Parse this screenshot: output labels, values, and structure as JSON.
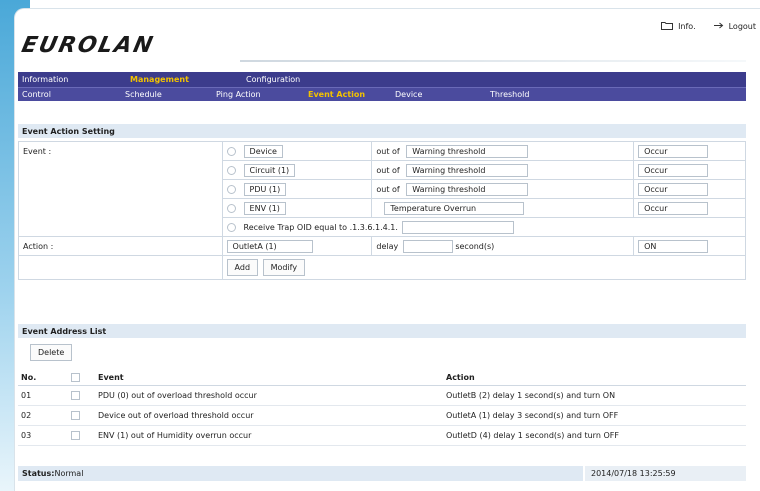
{
  "header": {
    "info_label": "Info.",
    "logout_label": "Logout",
    "logo_text": "EUROLAN"
  },
  "menu": {
    "primary": [
      "Information",
      "Management",
      "Configuration"
    ],
    "primary_active": "Management",
    "secondary": [
      "Control",
      "Schedule",
      "Ping Action",
      "Event Action",
      "Device",
      "Threshold"
    ],
    "secondary_active": "Event Action"
  },
  "event_action_setting": {
    "title": "Event Action Setting",
    "event_label": "Event :",
    "rows": [
      {
        "source": "Device",
        "out_of": "out of",
        "condition": "Warning threshold",
        "state": "Occur"
      },
      {
        "source": "Circuit (1)",
        "out_of": "out of",
        "condition": "Warning threshold",
        "state": "Occur"
      },
      {
        "source": "PDU (1)",
        "out_of": "out of",
        "condition": "Warning threshold",
        "state": "Occur"
      },
      {
        "source": "ENV (1)",
        "out_of": "",
        "condition": "Temperature Overrun",
        "state": "Occur"
      }
    ],
    "trap_label": "Receive Trap OID equal to",
    "trap_prefix": ".1.3.6.1.4.1.",
    "trap_value": "",
    "action_label": "Action :",
    "action_outlet": "OutletA (1)",
    "delay_label": "delay",
    "delay_value": "",
    "seconds_label": "second(s)",
    "action_state": "ON",
    "add_label": "Add",
    "modify_label": "Modify"
  },
  "event_address_list": {
    "title": "Event Address List",
    "delete_label": "Delete",
    "columns": {
      "no": "No.",
      "event": "Event",
      "action": "Action"
    },
    "rows": [
      {
        "no": "01",
        "event": "PDU (0) out of overload threshold occur",
        "action": "OutletB (2) delay 1 second(s) and turn ON"
      },
      {
        "no": "02",
        "event": "Device out of overload threshold occur",
        "action": "OutletA (1) delay 3 second(s) and turn OFF"
      },
      {
        "no": "03",
        "event": "ENV (1) out of Humidity overrun occur",
        "action": "OutletD (4) delay 1 second(s) and turn OFF"
      }
    ]
  },
  "status": {
    "label": "Status:",
    "value": "Normal",
    "timestamp": "2014/07/18 13:25:59"
  },
  "colors": {
    "menu_primary_bg": "#3c3c8c",
    "menu_secondary_bg": "#4b4b9e",
    "menu_active": "#f2c200",
    "section_bg": "#dfe9f3"
  },
  "icons": {
    "info": "folder-icon",
    "logout": "arrow-right-icon"
  }
}
